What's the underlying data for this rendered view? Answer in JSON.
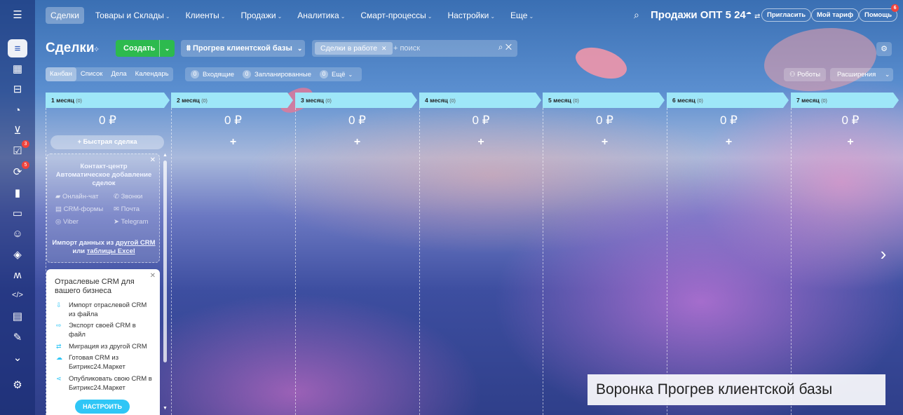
{
  "rail": {
    "menu_icon": "menu-icon",
    "items": [
      {
        "icon": "filter-icon",
        "glyph": "≡",
        "active": true
      },
      {
        "icon": "calendar-icon",
        "glyph": "▦"
      },
      {
        "icon": "inbox-icon",
        "glyph": "⊟"
      },
      {
        "icon": "analytics-icon",
        "glyph": "◔"
      },
      {
        "icon": "cart-icon",
        "glyph": "⊻"
      },
      {
        "icon": "tasks-icon",
        "glyph": "☑",
        "badge": "3"
      },
      {
        "icon": "sync-icon",
        "glyph": "⟳",
        "badge": "5"
      },
      {
        "icon": "chart-icon",
        "glyph": "▮"
      },
      {
        "icon": "monitor-icon",
        "glyph": "▭"
      },
      {
        "icon": "bot-icon",
        "glyph": "☺"
      },
      {
        "icon": "cube-icon",
        "glyph": "◈"
      },
      {
        "icon": "market-icon",
        "glyph": "ʍ"
      },
      {
        "icon": "code-icon",
        "glyph": "</>"
      },
      {
        "icon": "doc-icon",
        "glyph": "▤"
      },
      {
        "icon": "sign-icon",
        "glyph": "✎"
      },
      {
        "icon": "chevron-down-icon",
        "glyph": "⌄"
      },
      {
        "icon": "settings-icon",
        "glyph": "⚙"
      }
    ]
  },
  "topnav": {
    "items": [
      "Сделки",
      "Товары и Склады",
      "Клиенты",
      "Продажи",
      "Аналитика",
      "Смарт-процессы",
      "Настройки",
      "Еще"
    ],
    "portal": "Продажи ОПТ 5 24",
    "invite": "Пригласить",
    "tariff": "Мой тариф",
    "help": "Помощь",
    "help_badge": "6"
  },
  "header": {
    "title": "Сделки",
    "create_label": "Создать",
    "funnel_label": "Прогрев клиентской базы",
    "filter_chip": "Сделки в работе",
    "search_placeholder": "+ поиск"
  },
  "view": {
    "tabs": [
      "Канбан",
      "Список",
      "Дела",
      "Календарь"
    ],
    "counters": [
      {
        "count": "0",
        "label": "Входящие"
      },
      {
        "count": "0",
        "label": "Запланированные"
      },
      {
        "count": "0",
        "label": "Ещё"
      }
    ],
    "robots": "Роботы",
    "extensions": "Расширения"
  },
  "stages": [
    {
      "name": "1 месяц",
      "count": "(0)",
      "sum": "0 ₽"
    },
    {
      "name": "2 месяц",
      "count": "(0)",
      "sum": "0 ₽"
    },
    {
      "name": "3 месяц",
      "count": "(0)",
      "sum": "0 ₽"
    },
    {
      "name": "4 месяц",
      "count": "(0)",
      "sum": "0 ₽"
    },
    {
      "name": "5 месяц",
      "count": "(0)",
      "sum": "0 ₽"
    },
    {
      "name": "6 месяц",
      "count": "(0)",
      "sum": "0 ₽"
    },
    {
      "name": "7 месяц",
      "count": "(0)",
      "sum": "0 ₽"
    }
  ],
  "quick_deal": "Быстрая сделка",
  "contact_center": {
    "title_lines": [
      "Контакт-центр",
      "Автоматическое добавление",
      "сделок"
    ],
    "channels": [
      "Онлайн-чат",
      "Звонки",
      "CRM-формы",
      "Почта",
      "Viber",
      "Telegram"
    ],
    "import_prefix": "Импорт данных из",
    "import_link1": "другой CRM",
    "import_mid": "или",
    "import_link2": "таблицы Excel"
  },
  "industry": {
    "title": "Отраслевые CRM для вашего бизнеса",
    "items": [
      "Импорт отраслевой CRM из файла",
      "Экспорт своей CRM в файл",
      "Миграция из другой CRM",
      "Готовая CRM из Битрикс24.Маркет",
      "Опубликовать свою CRM в Битрикс24.Маркет"
    ],
    "setup_label": "НАСТРОИТЬ"
  },
  "caption": "Воронка Прогрев клиентской базы"
}
